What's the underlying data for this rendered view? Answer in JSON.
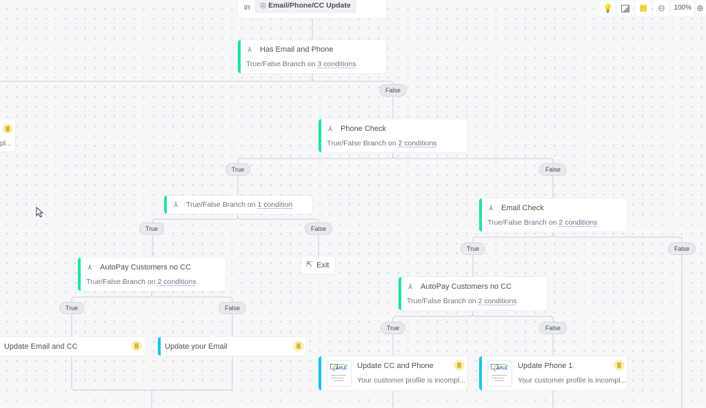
{
  "toolbar": {
    "zoom_level": "100%",
    "icons": [
      "lightbulb-icon",
      "image-icon",
      "sticky-note-icon",
      "zoom-out-icon",
      "zoom-in-icon"
    ]
  },
  "trigger": {
    "prefix": "in",
    "segment": "Email/Phone/CC Update",
    "segment_icon": "segment-icon"
  },
  "nodes": {
    "has_email_phone": {
      "title": "Has Email and Phone",
      "sub_prefix": "True/False Branch on ",
      "sub_link": "3 conditions"
    },
    "left_partial": {
      "sub": "pl..."
    },
    "phone_check": {
      "title": "Phone Check",
      "sub_prefix": "True/False Branch on ",
      "sub_link": "2 conditions"
    },
    "one_condition": {
      "sub_prefix": "True/False Branch on ",
      "sub_link": "1 condition"
    },
    "exit": {
      "label": "Exit"
    },
    "autopay_left": {
      "title": "AutoPay Customers no CC",
      "sub_prefix": "True/False Branch on ",
      "sub_link": "2 conditions"
    },
    "update_email_cc": {
      "title": "Update Email and CC"
    },
    "update_your_email": {
      "title": "Update your Email"
    },
    "email_check": {
      "title": "Email Check",
      "sub_prefix": "True/False Branch on ",
      "sub_link": "2 conditions"
    },
    "autopay_right": {
      "title": "AutoPay Customers no CC",
      "sub_prefix": "True/False Branch on ",
      "sub_link": "2 conditions"
    },
    "update_cc_phone": {
      "title": "Update CC and Phone",
      "preview": "Your customer profile is incompl..."
    },
    "update_phone_1": {
      "title": "Update Phone 1",
      "preview": "Your customer profile is incompl..."
    }
  },
  "branch_labels": {
    "true": "True",
    "false": "False"
  },
  "thumbnail": {
    "logo": "APLE"
  },
  "colors": {
    "condition_accent": "#1ee3a6",
    "message_accent": "#18c5e8",
    "link_underline": "#9b6ce8",
    "doc_badge": "#fbefb4"
  }
}
